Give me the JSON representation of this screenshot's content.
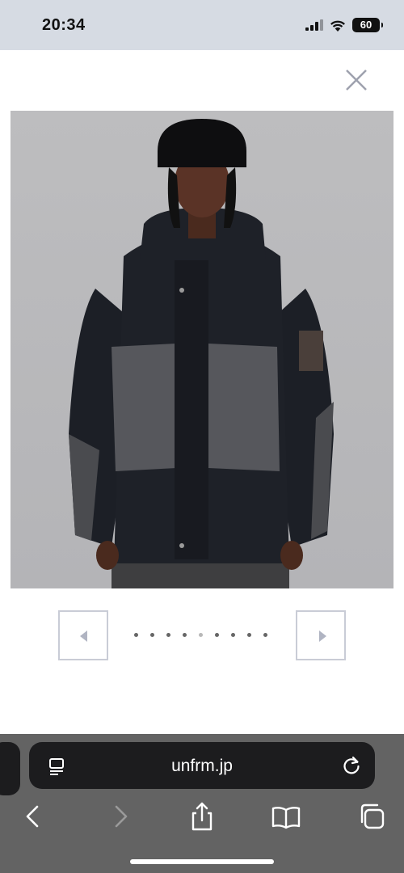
{
  "status_bar": {
    "time": "20:34",
    "battery": "60",
    "icons": [
      "cellular-signal-icon",
      "wifi-icon",
      "battery-icon"
    ]
  },
  "viewer": {
    "close_icon": "close-icon",
    "image_alt": "",
    "carousel": {
      "prev_icon": "triangle-left-icon",
      "next_icon": "triangle-right-icon",
      "dot_count": 9,
      "active_index": 4
    }
  },
  "browser": {
    "url": "unfrm.jp",
    "left_icon": "reader-mode-icon",
    "reload_icon": "reload-icon",
    "toolbar": [
      "back-icon",
      "forward-icon",
      "share-icon",
      "bookmarks-icon",
      "tabs-icon"
    ]
  },
  "colors": {
    "status_bar_bg": "#d6dbe3",
    "photo_bg": "#b8b8bb",
    "browser_bg": "#636363",
    "url_bar_bg": "#1c1c1e",
    "arrow_border": "#c9ccd6"
  }
}
